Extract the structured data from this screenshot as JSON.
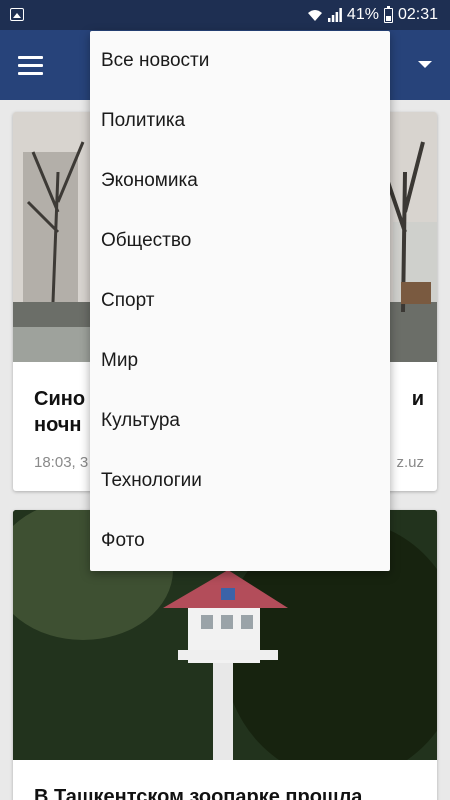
{
  "status_bar": {
    "battery": "41%",
    "time": "02:31",
    "icons": [
      "gallery-icon",
      "wifi-icon",
      "signal-icon",
      "battery-icon"
    ]
  },
  "app_bar": {
    "background": "#27437a",
    "icons": [
      "menu-icon",
      "dropdown-arrow-icon"
    ]
  },
  "dropdown": {
    "items": [
      "Все новости",
      "Политика",
      "Экономика",
      "Общество",
      "Спорт",
      "Мир",
      "Культура",
      "Технологии",
      "Фото"
    ]
  },
  "cards": [
    {
      "title_left": "Сино",
      "title_right": "и",
      "title_line2": "ночн",
      "meta_left": "18:03, 3",
      "meta_right": "z.uz"
    },
    {
      "title": "В Ташкентском зоопарке прошла"
    }
  ]
}
